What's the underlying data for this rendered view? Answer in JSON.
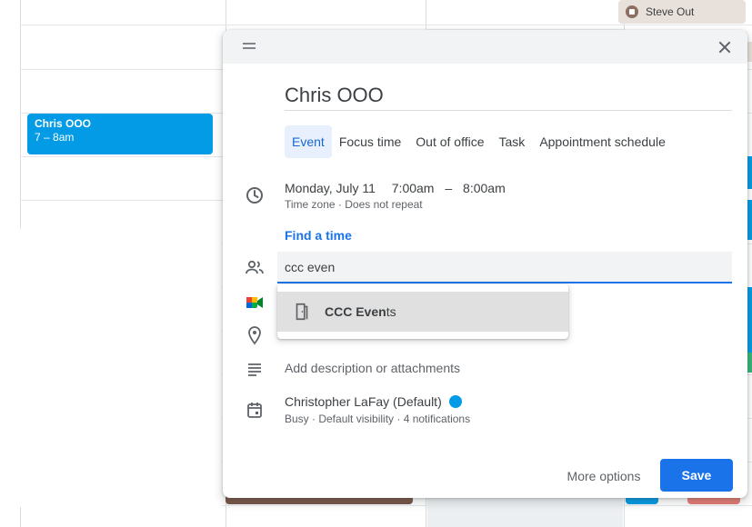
{
  "background": {
    "event": {
      "title": "Chris OOO",
      "time": "7 – 8am",
      "color": "#039be5"
    },
    "chip": {
      "label": "Steve Out",
      "icon": "out-of-office-icon"
    }
  },
  "dialog": {
    "title": "Chris OOO",
    "tabs": [
      {
        "label": "Event",
        "active": true
      },
      {
        "label": "Focus time"
      },
      {
        "label": "Out of office"
      },
      {
        "label": "Task"
      },
      {
        "label": "Appointment schedule"
      }
    ],
    "date": "Monday, July 11",
    "start_time": "7:00am",
    "dash": "–",
    "end_time": "8:00am",
    "time_meta": "Time zone · Does not repeat",
    "find_time": "Find a time",
    "guest_input": "ccc even",
    "suggestion": {
      "match": "CCC Even",
      "rest": "ts",
      "icon": "room-door-icon"
    },
    "description_placeholder": "Add description or attachments",
    "calendar": "Christopher LaFay (Default)",
    "calendar_color": "#039be5",
    "calendar_meta": "Busy · Default visibility · 4 notifications",
    "more_options": "More options",
    "save": "Save",
    "accent": "#1a73e8"
  }
}
